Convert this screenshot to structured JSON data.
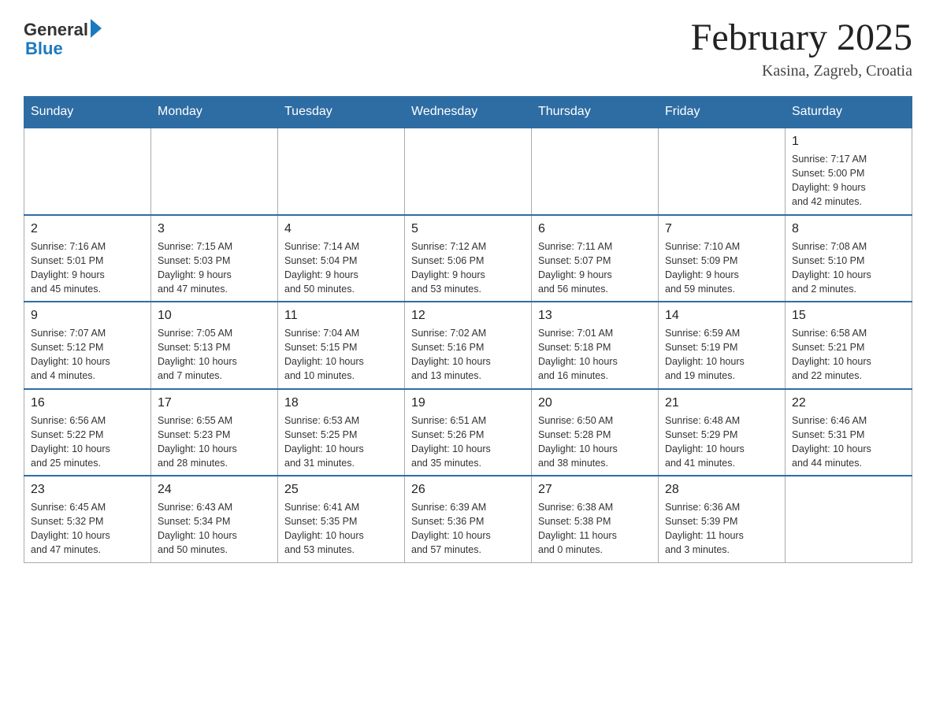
{
  "header": {
    "logo_general": "General",
    "logo_blue": "Blue",
    "month_title": "February 2025",
    "location": "Kasina, Zagreb, Croatia"
  },
  "weekdays": [
    "Sunday",
    "Monday",
    "Tuesday",
    "Wednesday",
    "Thursday",
    "Friday",
    "Saturday"
  ],
  "weeks": [
    {
      "days": [
        {
          "number": "",
          "info": ""
        },
        {
          "number": "",
          "info": ""
        },
        {
          "number": "",
          "info": ""
        },
        {
          "number": "",
          "info": ""
        },
        {
          "number": "",
          "info": ""
        },
        {
          "number": "",
          "info": ""
        },
        {
          "number": "1",
          "info": "Sunrise: 7:17 AM\nSunset: 5:00 PM\nDaylight: 9 hours\nand 42 minutes."
        }
      ]
    },
    {
      "days": [
        {
          "number": "2",
          "info": "Sunrise: 7:16 AM\nSunset: 5:01 PM\nDaylight: 9 hours\nand 45 minutes."
        },
        {
          "number": "3",
          "info": "Sunrise: 7:15 AM\nSunset: 5:03 PM\nDaylight: 9 hours\nand 47 minutes."
        },
        {
          "number": "4",
          "info": "Sunrise: 7:14 AM\nSunset: 5:04 PM\nDaylight: 9 hours\nand 50 minutes."
        },
        {
          "number": "5",
          "info": "Sunrise: 7:12 AM\nSunset: 5:06 PM\nDaylight: 9 hours\nand 53 minutes."
        },
        {
          "number": "6",
          "info": "Sunrise: 7:11 AM\nSunset: 5:07 PM\nDaylight: 9 hours\nand 56 minutes."
        },
        {
          "number": "7",
          "info": "Sunrise: 7:10 AM\nSunset: 5:09 PM\nDaylight: 9 hours\nand 59 minutes."
        },
        {
          "number": "8",
          "info": "Sunrise: 7:08 AM\nSunset: 5:10 PM\nDaylight: 10 hours\nand 2 minutes."
        }
      ]
    },
    {
      "days": [
        {
          "number": "9",
          "info": "Sunrise: 7:07 AM\nSunset: 5:12 PM\nDaylight: 10 hours\nand 4 minutes."
        },
        {
          "number": "10",
          "info": "Sunrise: 7:05 AM\nSunset: 5:13 PM\nDaylight: 10 hours\nand 7 minutes."
        },
        {
          "number": "11",
          "info": "Sunrise: 7:04 AM\nSunset: 5:15 PM\nDaylight: 10 hours\nand 10 minutes."
        },
        {
          "number": "12",
          "info": "Sunrise: 7:02 AM\nSunset: 5:16 PM\nDaylight: 10 hours\nand 13 minutes."
        },
        {
          "number": "13",
          "info": "Sunrise: 7:01 AM\nSunset: 5:18 PM\nDaylight: 10 hours\nand 16 minutes."
        },
        {
          "number": "14",
          "info": "Sunrise: 6:59 AM\nSunset: 5:19 PM\nDaylight: 10 hours\nand 19 minutes."
        },
        {
          "number": "15",
          "info": "Sunrise: 6:58 AM\nSunset: 5:21 PM\nDaylight: 10 hours\nand 22 minutes."
        }
      ]
    },
    {
      "days": [
        {
          "number": "16",
          "info": "Sunrise: 6:56 AM\nSunset: 5:22 PM\nDaylight: 10 hours\nand 25 minutes."
        },
        {
          "number": "17",
          "info": "Sunrise: 6:55 AM\nSunset: 5:23 PM\nDaylight: 10 hours\nand 28 minutes."
        },
        {
          "number": "18",
          "info": "Sunrise: 6:53 AM\nSunset: 5:25 PM\nDaylight: 10 hours\nand 31 minutes."
        },
        {
          "number": "19",
          "info": "Sunrise: 6:51 AM\nSunset: 5:26 PM\nDaylight: 10 hours\nand 35 minutes."
        },
        {
          "number": "20",
          "info": "Sunrise: 6:50 AM\nSunset: 5:28 PM\nDaylight: 10 hours\nand 38 minutes."
        },
        {
          "number": "21",
          "info": "Sunrise: 6:48 AM\nSunset: 5:29 PM\nDaylight: 10 hours\nand 41 minutes."
        },
        {
          "number": "22",
          "info": "Sunrise: 6:46 AM\nSunset: 5:31 PM\nDaylight: 10 hours\nand 44 minutes."
        }
      ]
    },
    {
      "days": [
        {
          "number": "23",
          "info": "Sunrise: 6:45 AM\nSunset: 5:32 PM\nDaylight: 10 hours\nand 47 minutes."
        },
        {
          "number": "24",
          "info": "Sunrise: 6:43 AM\nSunset: 5:34 PM\nDaylight: 10 hours\nand 50 minutes."
        },
        {
          "number": "25",
          "info": "Sunrise: 6:41 AM\nSunset: 5:35 PM\nDaylight: 10 hours\nand 53 minutes."
        },
        {
          "number": "26",
          "info": "Sunrise: 6:39 AM\nSunset: 5:36 PM\nDaylight: 10 hours\nand 57 minutes."
        },
        {
          "number": "27",
          "info": "Sunrise: 6:38 AM\nSunset: 5:38 PM\nDaylight: 11 hours\nand 0 minutes."
        },
        {
          "number": "28",
          "info": "Sunrise: 6:36 AM\nSunset: 5:39 PM\nDaylight: 11 hours\nand 3 minutes."
        },
        {
          "number": "",
          "info": ""
        }
      ]
    }
  ]
}
